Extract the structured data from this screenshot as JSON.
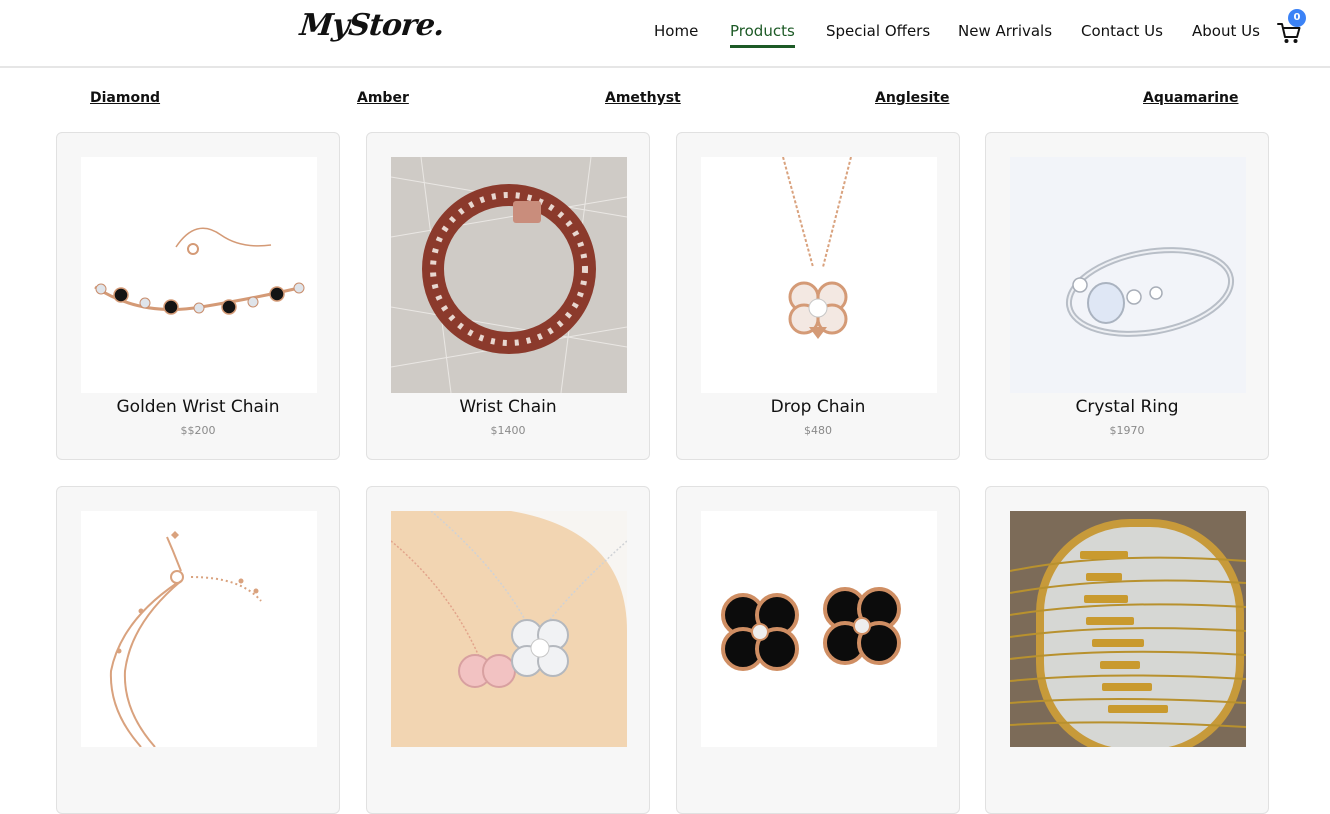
{
  "header": {
    "logo": "MyStore.",
    "nav": [
      {
        "label": "Home"
      },
      {
        "label": "Products",
        "active": true
      },
      {
        "label": "Special Offers"
      },
      {
        "label": "New Arrivals"
      },
      {
        "label": "Contact Us"
      },
      {
        "label": "About Us"
      }
    ],
    "cart": {
      "icon": "cart-icon",
      "count": "0"
    }
  },
  "categories": [
    "Diamond",
    "Amber",
    "Amethyst",
    "Anglesite",
    "Aquamarine"
  ],
  "products": [
    {
      "name": "Golden Wrist Chain",
      "price": "$$200",
      "image": "rose-gold-clover-bracelet"
    },
    {
      "name": "Wrist Chain",
      "price": "$1400",
      "image": "cuban-link-bracelet-on-fur"
    },
    {
      "name": "Drop Chain",
      "price": "$480",
      "image": "clover-pendant-necklace"
    },
    {
      "name": "Crystal Ring",
      "price": "$1970",
      "image": "opal-silver-ring"
    },
    {
      "name": "",
      "price": "",
      "image": "beaded-chain-bracelet"
    },
    {
      "name": "",
      "price": "",
      "image": "clover-pendant-necklaces"
    },
    {
      "name": "",
      "price": "",
      "image": "black-clover-earrings"
    },
    {
      "name": "",
      "price": "",
      "image": "zodiac-name-necklaces"
    }
  ],
  "colors": {
    "active_nav": "#1d5a26",
    "badge": "#3b82f6",
    "card_bg": "#f7f7f7",
    "price_text": "#8a8a8a"
  }
}
